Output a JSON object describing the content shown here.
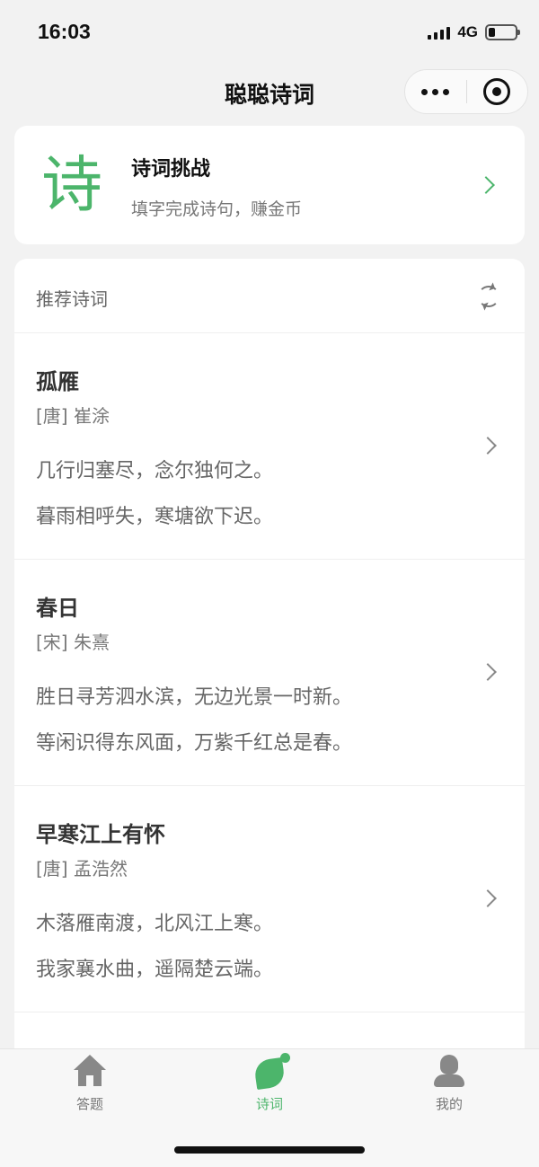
{
  "status_bar": {
    "time": "16:03",
    "network": "4G",
    "battery_level": 0.25
  },
  "nav": {
    "title": "聪聪诗词"
  },
  "challenge": {
    "logo_char": "诗",
    "title": "诗词挑战",
    "subtitle": "填字完成诗句，赚金币"
  },
  "list": {
    "header": "推荐诗词",
    "poems": [
      {
        "title": "孤雁",
        "author": "[唐] 崔涂",
        "lines": [
          "几行归塞尽，念尔独何之。",
          "暮雨相呼失，寒塘欲下迟。"
        ]
      },
      {
        "title": "春日",
        "author": "[宋] 朱熹",
        "lines": [
          "胜日寻芳泗水滨，无边光景一时新。",
          "等闲识得东风面，万紫千红总是春。"
        ]
      },
      {
        "title": "早寒江上有怀",
        "author": "[唐] 孟浩然",
        "lines": [
          "木落雁南渡，北风江上寒。",
          "我家襄水曲，遥隔楚云端。"
        ]
      }
    ]
  },
  "tabbar": {
    "tabs": [
      {
        "label": "答题",
        "icon": "home-icon"
      },
      {
        "label": "诗词",
        "icon": "leaf-icon",
        "active": true
      },
      {
        "label": "我的",
        "icon": "person-icon"
      }
    ]
  },
  "colors": {
    "accent": "#4cb56b",
    "background": "#f2f2f2",
    "card": "#ffffff"
  }
}
